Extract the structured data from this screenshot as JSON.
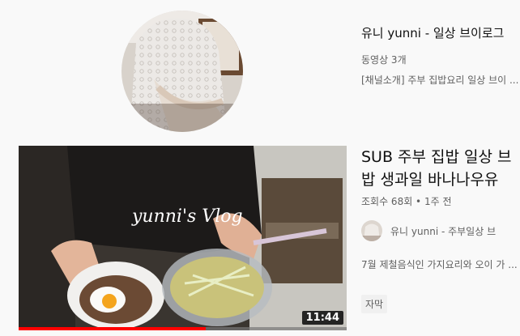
{
  "channel": {
    "name": "유니 yunni - 일상 브이로그",
    "video_count": "동영상 3개",
    "description": "[채널소개] 주부 집밥요리 일상 브이 ..."
  },
  "video": {
    "title_line1": "SUB 주부 집밥 일상 브",
    "title_line2": "밥 생과일 바나나우유",
    "meta": "조회수 68회 • 1주 전",
    "owner_name": "유니 yunni - 주부일상 브",
    "description": "7월 제철음식인 가지요리와 오이 가 ...",
    "badge": "자막",
    "duration": "11:44",
    "thumbnail_text": "yunni's Vlog",
    "watched_fraction": 0.57
  },
  "colors": {
    "progress": "#ff0000",
    "secondary_text": "#606060",
    "background": "#f9f9f9"
  },
  "icons": {
    "channel_avatar": "channel-avatar-icon",
    "owner_avatar": "owner-avatar-icon"
  }
}
